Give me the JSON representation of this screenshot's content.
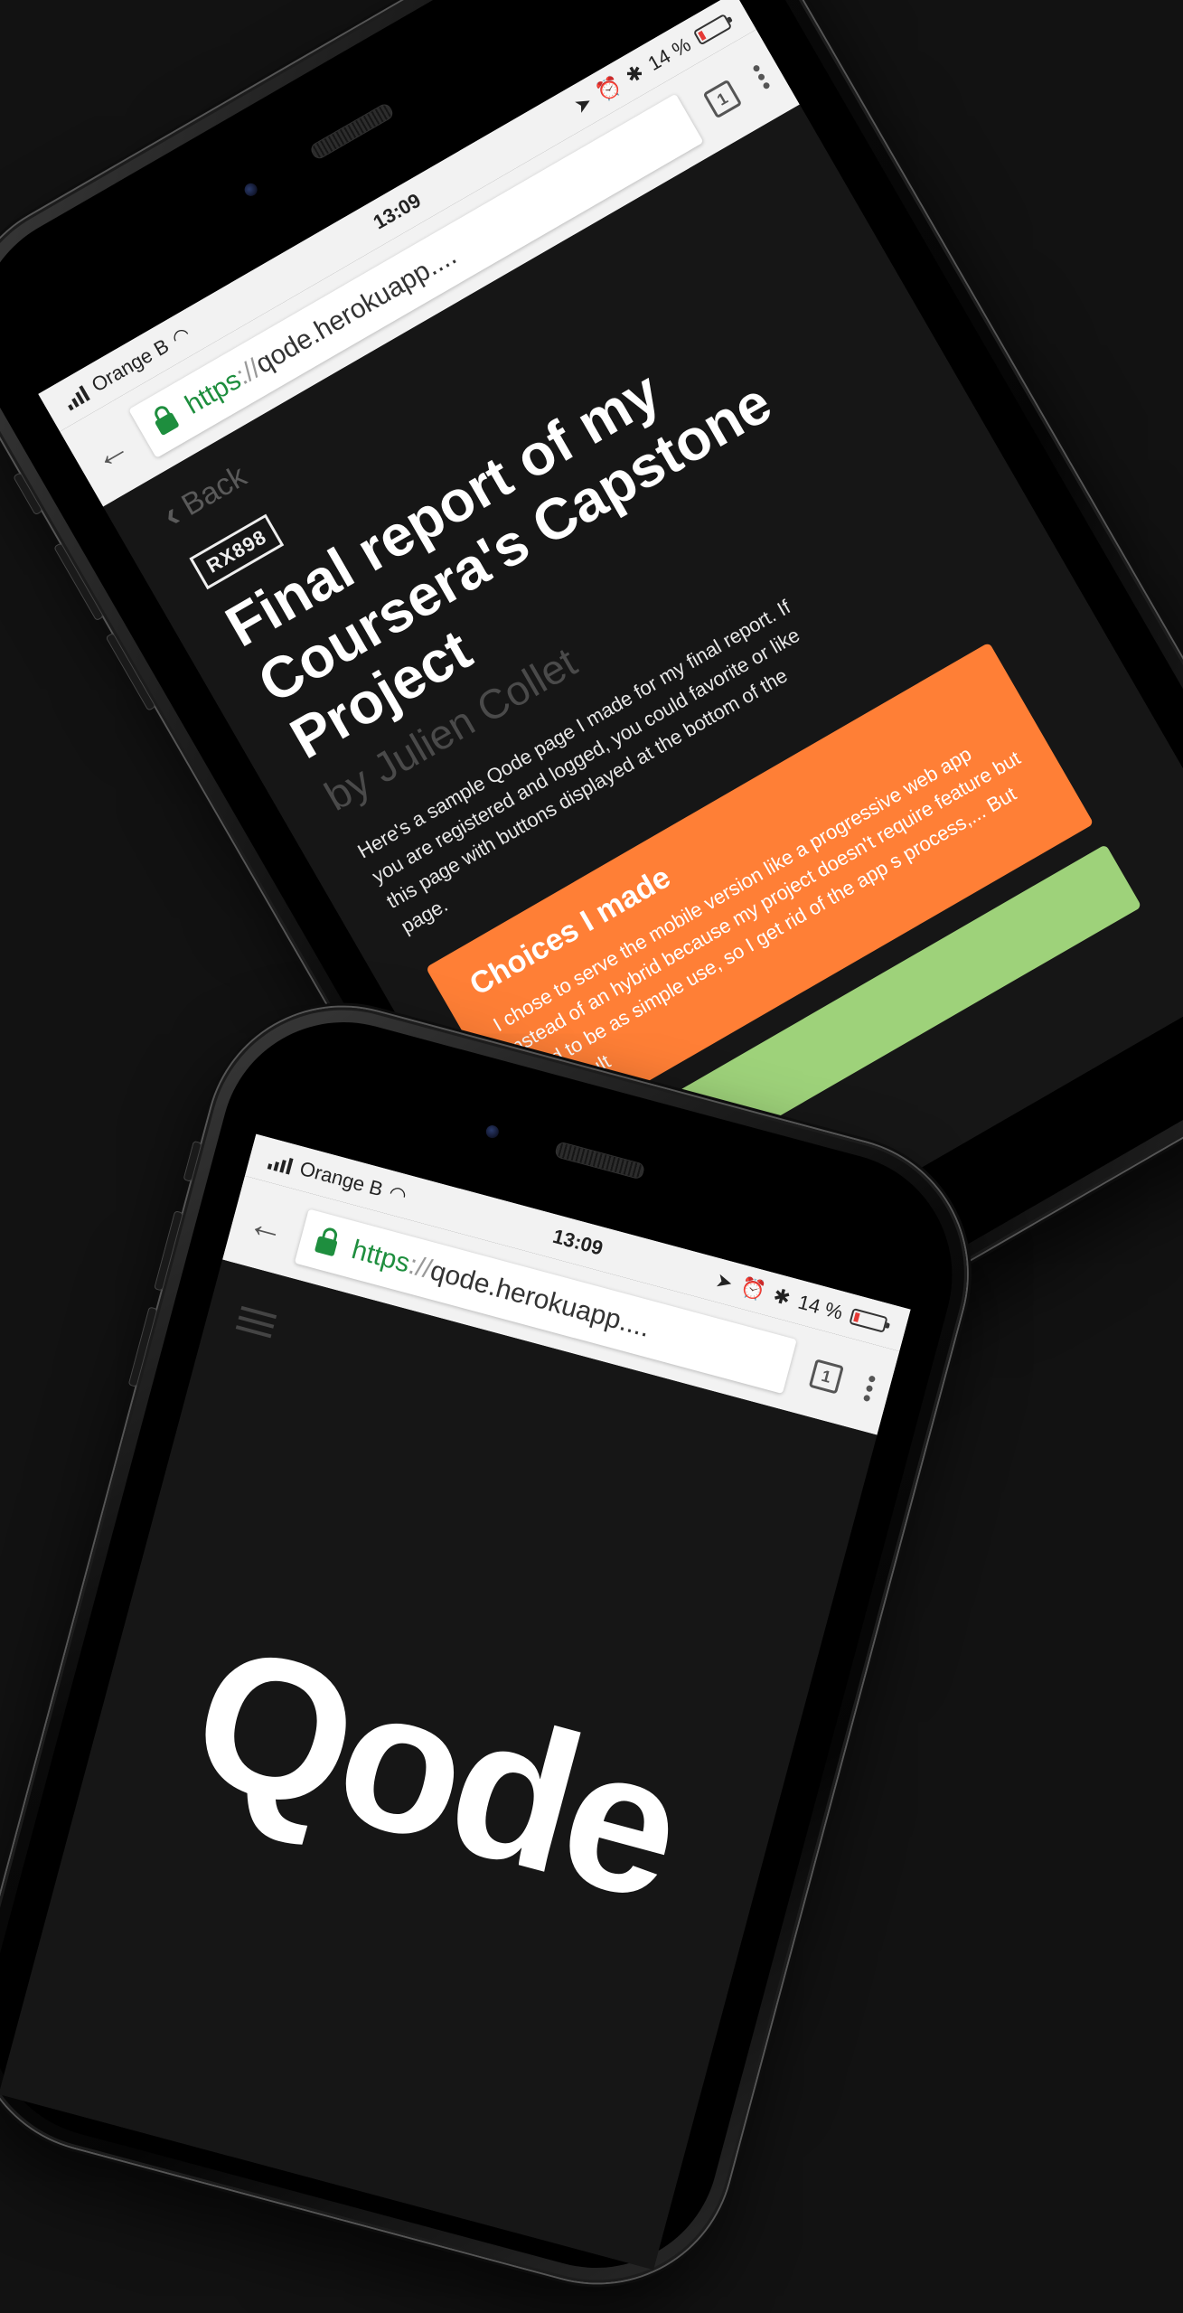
{
  "phones": [
    {
      "id": "phone-article",
      "status": {
        "carrier": "Orange B",
        "time": "13:09",
        "battery": "14 %",
        "battery_level": 0.14
      },
      "browser": {
        "url_scheme": "https",
        "url_sep": "://",
        "url_host": "qode.herokuapp....",
        "tab_count": "1"
      },
      "page": {
        "back_label": "Back",
        "badge": "RX898",
        "title": "Final report of my Coursera's Capstone Project",
        "author": "by Julien Collet",
        "intro": "Here's a sample Qode page I made for my final report. If you are registered and logged, you could favorite or like this page with buttons displayed at the bottom of the page.",
        "card_heading": "Choices I made",
        "card_text": "I chose to serve the mobile version like a progressive web app instead of an hybrid because my project doesn't require feature but need to be as simple use, so I get rid of the app s process,... But the result"
      }
    },
    {
      "id": "phone-home",
      "status": {
        "carrier": "Orange B",
        "time": "13:09",
        "battery": "14 %",
        "battery_level": 0.14
      },
      "browser": {
        "url_scheme": "https",
        "url_sep": "://",
        "url_host": "qode.herokuapp....",
        "tab_count": "1"
      },
      "page": {
        "logo": "Qode"
      }
    }
  ],
  "colors": {
    "background": "#121212",
    "screen_bg": "#161616",
    "accent_orange": "#ff7f36",
    "accent_green": "#9ed27a",
    "secure_green": "#1e8e3e"
  }
}
